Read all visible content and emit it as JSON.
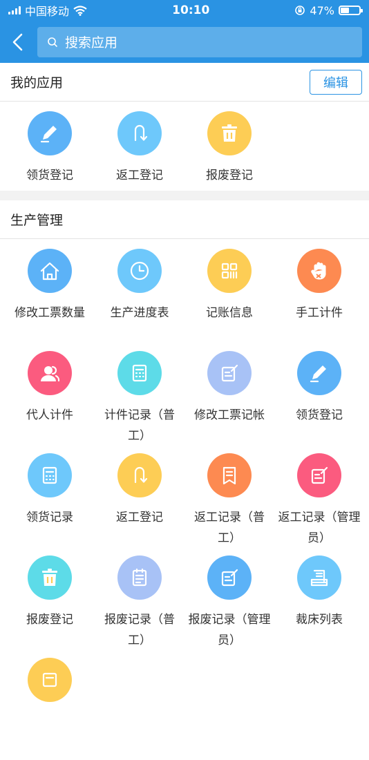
{
  "status_bar": {
    "carrier": "中国移动",
    "time": "10:10",
    "battery": "47%",
    "battery_level": 0.47
  },
  "header": {
    "search_placeholder": "搜索应用"
  },
  "my_apps": {
    "title": "我的应用",
    "edit_label": "编辑",
    "items": [
      {
        "label": "领货登记",
        "icon": "pencil-icon",
        "color": "#5cb2f7"
      },
      {
        "label": "返工登记",
        "icon": "u-turn-icon",
        "color": "#6ec8fb"
      },
      {
        "label": "报废登记",
        "icon": "trash-icon",
        "color": "#fdcd55"
      }
    ]
  },
  "production": {
    "title": "生产管理",
    "items": [
      {
        "label": "修改工票数量",
        "icon": "home-icon",
        "color": "#5cb2f7"
      },
      {
        "label": "生产进度表",
        "icon": "clock-icon",
        "color": "#6ec8fb"
      },
      {
        "label": "记账信息",
        "icon": "qr-grid-icon",
        "color": "#fdcd55"
      },
      {
        "label": "手工计件",
        "icon": "hand-icon",
        "color": "#fd8a51"
      },
      {
        "label": "代人计件",
        "icon": "users-icon",
        "color": "#fb5b7f"
      },
      {
        "label": "计件记录（普工）",
        "icon": "calculator-icon",
        "color": "#5ddbe8"
      },
      {
        "label": "修改工票记帐",
        "icon": "edit-doc-icon",
        "color": "#a8c2f6"
      },
      {
        "label": "领货登记",
        "icon": "pencil-icon",
        "color": "#5cb2f7"
      },
      {
        "label": "领货记录",
        "icon": "record-icon",
        "color": "#6ec8fb"
      },
      {
        "label": "返工登记",
        "icon": "u-turn-icon",
        "color": "#fdcd55"
      },
      {
        "label": "返工记录（普工）",
        "icon": "bookmark-doc-icon",
        "color": "#fd8a51"
      },
      {
        "label": "返工记录（管理员）",
        "icon": "edit-doc-icon",
        "color": "#fb5b7f"
      },
      {
        "label": "报废登记",
        "icon": "trash-icon",
        "color": "#5ddbe8"
      },
      {
        "label": "报废记录（普工）",
        "icon": "clipboard-icon",
        "color": "#a8c2f6"
      },
      {
        "label": "报废记录（管理员）",
        "icon": "edit-doc-icon",
        "color": "#5cb2f7"
      },
      {
        "label": "裁床列表",
        "icon": "stack-doc-icon",
        "color": "#6ec8fb"
      },
      {
        "label": "",
        "icon": "box-icon",
        "color": "#fdcd55"
      }
    ]
  }
}
